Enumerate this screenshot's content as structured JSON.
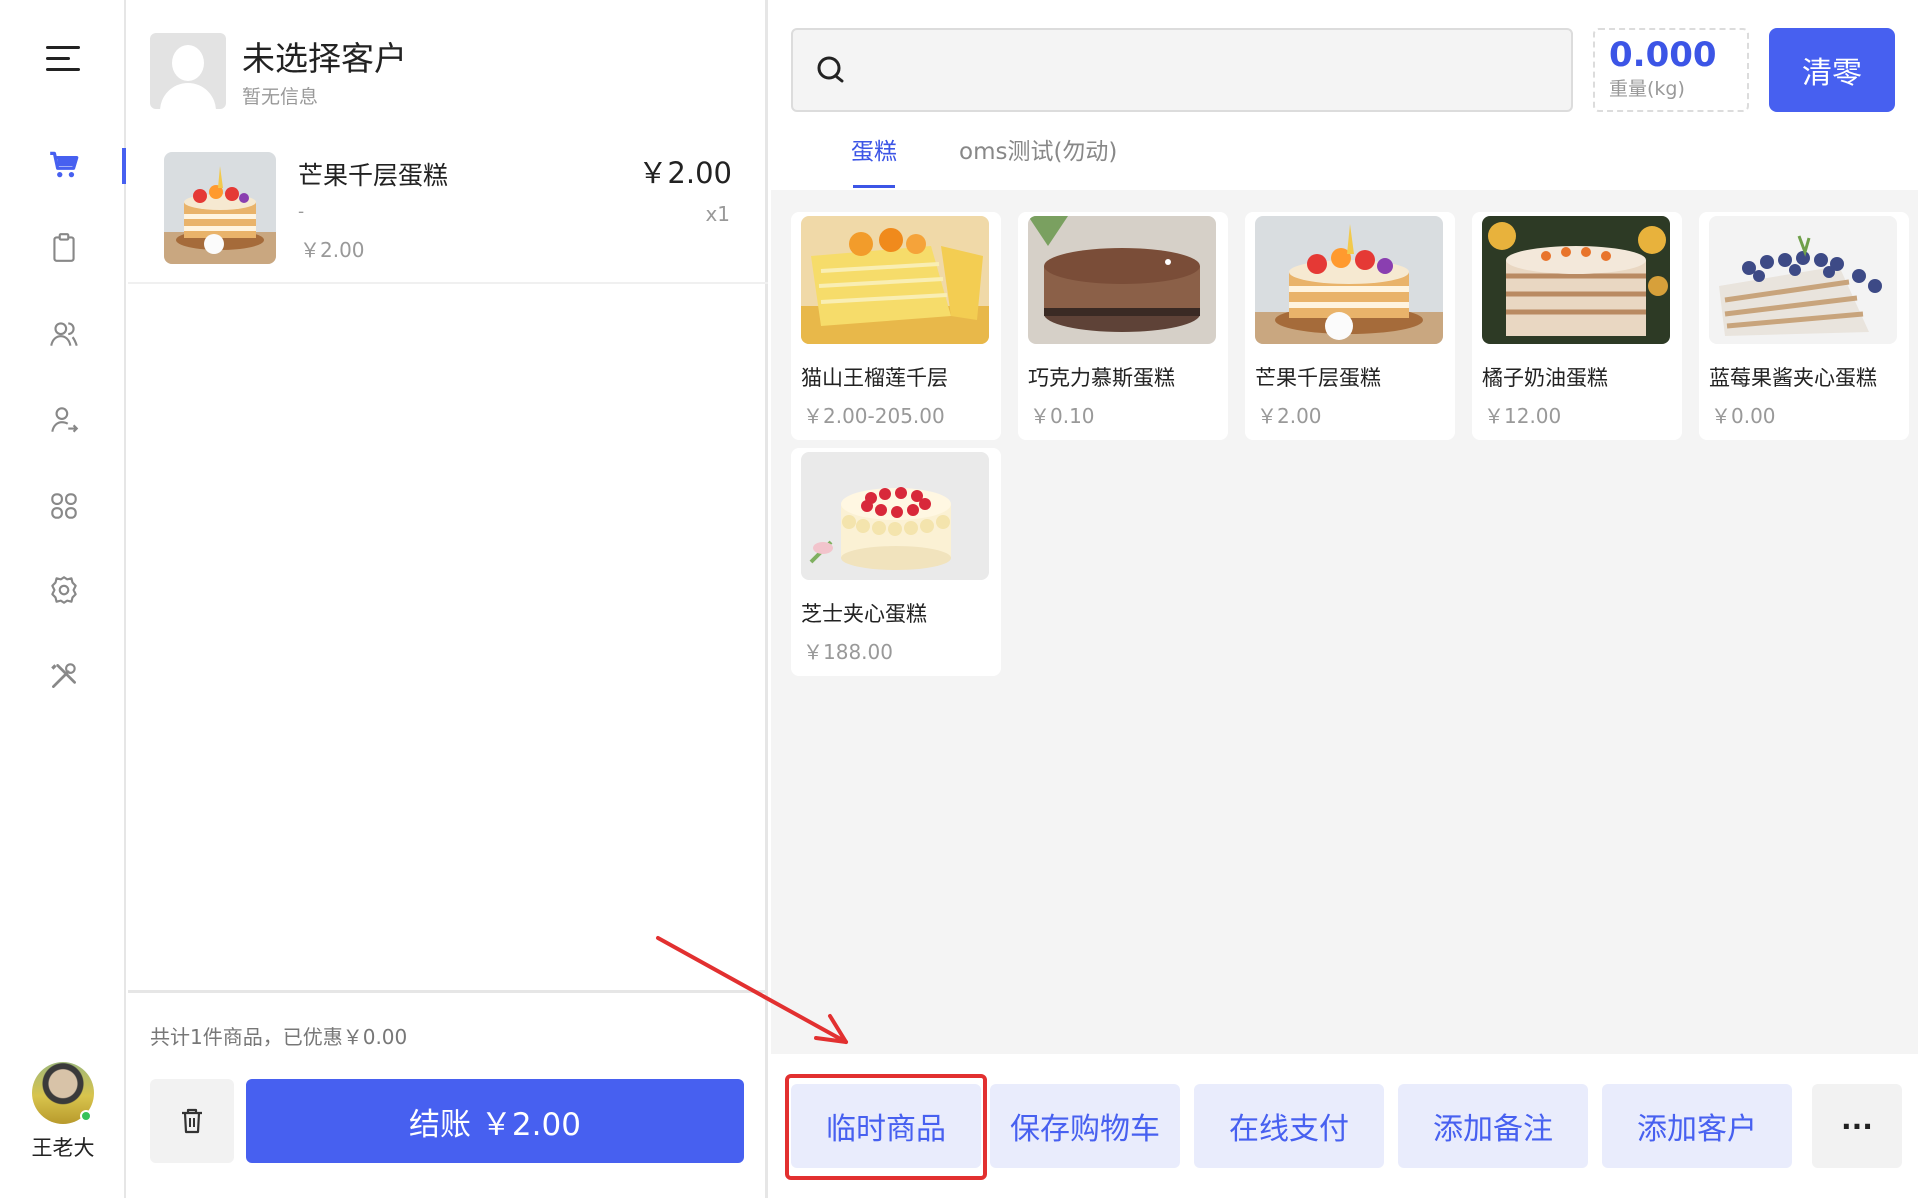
{
  "user": {
    "name": "王老大"
  },
  "customer": {
    "title": "未选择客户",
    "subtitle": "暂无信息"
  },
  "cart": {
    "items": [
      {
        "name": "芒果千层蛋糕",
        "spec": "-",
        "unit_price": "￥2.00",
        "total": "￥2.00",
        "qty": "x1"
      }
    ],
    "summary": "共计1件商品，已优惠￥0.00",
    "checkout_label": "结账 ￥2.00"
  },
  "scale": {
    "value": "0.000",
    "unit": "重量(kg)"
  },
  "zero_label": "清零",
  "tabs": [
    {
      "label": "蛋糕",
      "active": true
    },
    {
      "label": "oms测试(勿动)",
      "active": false
    }
  ],
  "products": [
    {
      "name": "猫山王榴莲千层",
      "price": "￥2.00-205.00"
    },
    {
      "name": "巧克力慕斯蛋糕",
      "price": "￥0.10"
    },
    {
      "name": "芒果千层蛋糕",
      "price": "￥2.00"
    },
    {
      "name": "橘子奶油蛋糕",
      "price": "￥12.00"
    },
    {
      "name": "蓝莓果酱夹心蛋糕",
      "price": "￥0.00"
    },
    {
      "name": "芝士夹心蛋糕",
      "price": "￥188.00"
    }
  ],
  "actions": [
    {
      "label": "临时商品"
    },
    {
      "label": "保存购物车"
    },
    {
      "label": "在线支付"
    },
    {
      "label": "添加备注"
    },
    {
      "label": "添加客户"
    }
  ],
  "more_label": "···",
  "colors": {
    "accent": "#4760f0",
    "highlight": "#e23030"
  }
}
